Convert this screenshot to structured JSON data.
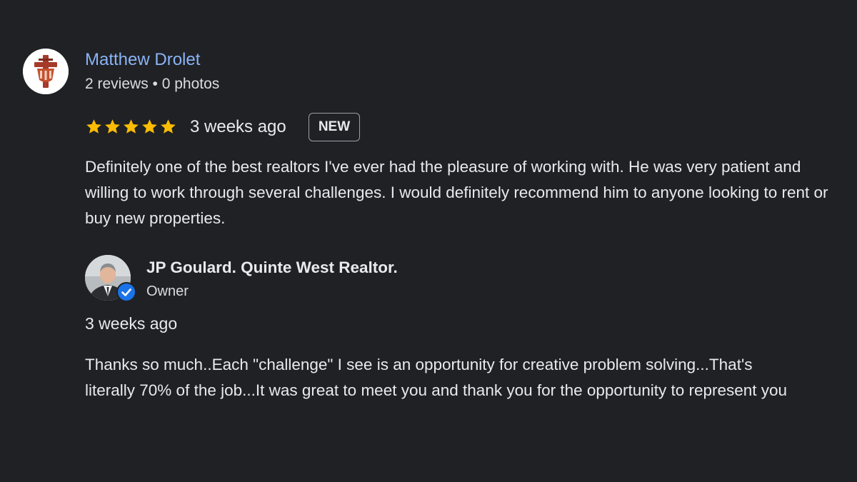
{
  "review": {
    "reviewer": {
      "name": "Matthew Drolet",
      "meta": "2 reviews • 0 photos",
      "avatar_icon": "red-cross-crest-icon"
    },
    "rating": {
      "stars": 5,
      "max_stars": 5,
      "star_color": "#fbbc04"
    },
    "time": "3 weeks ago",
    "badge": "NEW",
    "text": "Definitely one of the best realtors I've ever had the pleasure of working with. He was very patient and willing to work through several challenges. I would definitely recommend him to anyone looking to rent or buy new properties."
  },
  "owner_response": {
    "name": "JP Goulard. Quinte West Realtor.",
    "role": "Owner",
    "avatar_icon": "owner-portrait-photo",
    "verified_icon": "verified-check-icon",
    "time": "3 weeks ago",
    "text": "Thanks so much..Each \"challenge\" I see is an opportunity for creative problem solving...That's literally 70% of the job...It was great to meet you and thank you for the opportunity to represent you"
  },
  "colors": {
    "background": "#202124",
    "link": "#8ab4f8",
    "text": "#e8eaed",
    "verified": "#1a73e8"
  }
}
